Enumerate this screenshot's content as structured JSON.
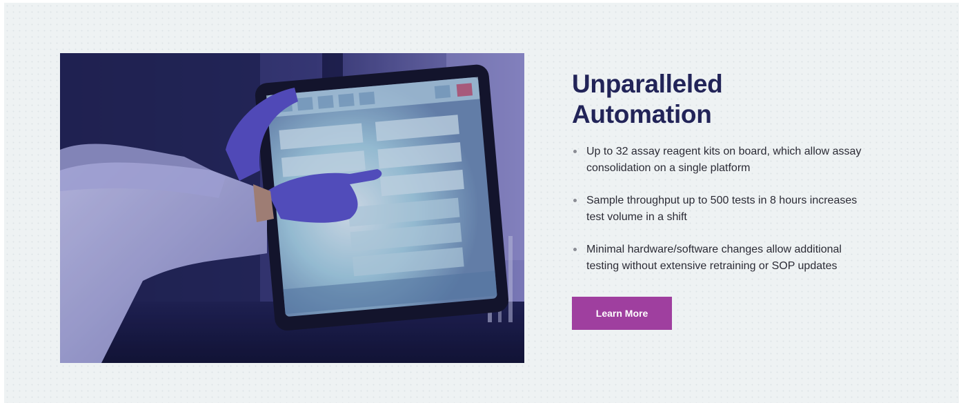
{
  "feature": {
    "image_alt": "Gloved hand operating an instrument touchscreen",
    "heading_line1": "Unparalleled",
    "heading_line2": "Automation",
    "bullets": [
      "Up to 32 assay reagent kits on board, which allow assay consolidation on a single platform",
      "Sample throughput up to 500 tests in 8 hours increases test volume in a shift",
      "Minimal hardware/software changes allow additional testing without extensive retraining or SOP updates"
    ],
    "cta_label": "Learn More"
  },
  "colors": {
    "heading": "#222458",
    "button": "#9f3f9f",
    "background": "#eef2f3",
    "bullet_dot": "#8a8c94"
  }
}
